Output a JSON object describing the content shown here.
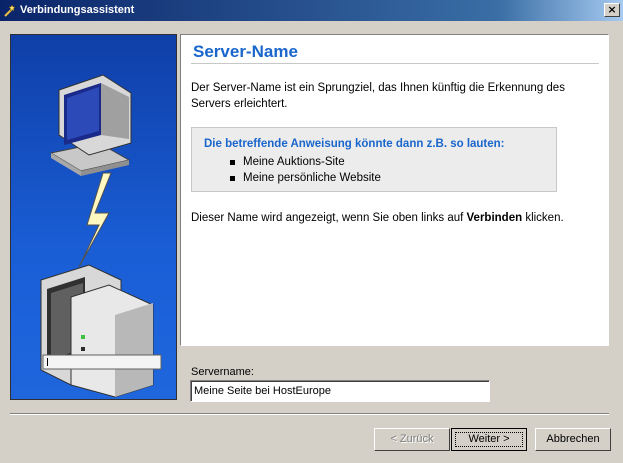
{
  "window": {
    "title": "Verbindungsassistent",
    "close_label": "×"
  },
  "page": {
    "heading": "Server-Name",
    "intro": "Der Server-Name ist ein Sprungziel, das Ihnen künftig die Erkennung des Servers erleichtert.",
    "example": {
      "title": "Die betreffende Anweisung könnte dann z.B. so lauten:",
      "items": [
        "Meine Auktions-Site",
        "Meine persönliche Website"
      ]
    },
    "note_prefix": "Dieser Name wird angezeigt, wenn Sie oben links auf ",
    "note_bold": "Verbinden",
    "note_suffix": " klicken."
  },
  "form": {
    "servername_label": "Servername:",
    "servername_value": "Meine Seite bei HostEurope"
  },
  "buttons": {
    "back": "< Zurück",
    "next": "Weiter >",
    "cancel": "Abbrechen"
  }
}
